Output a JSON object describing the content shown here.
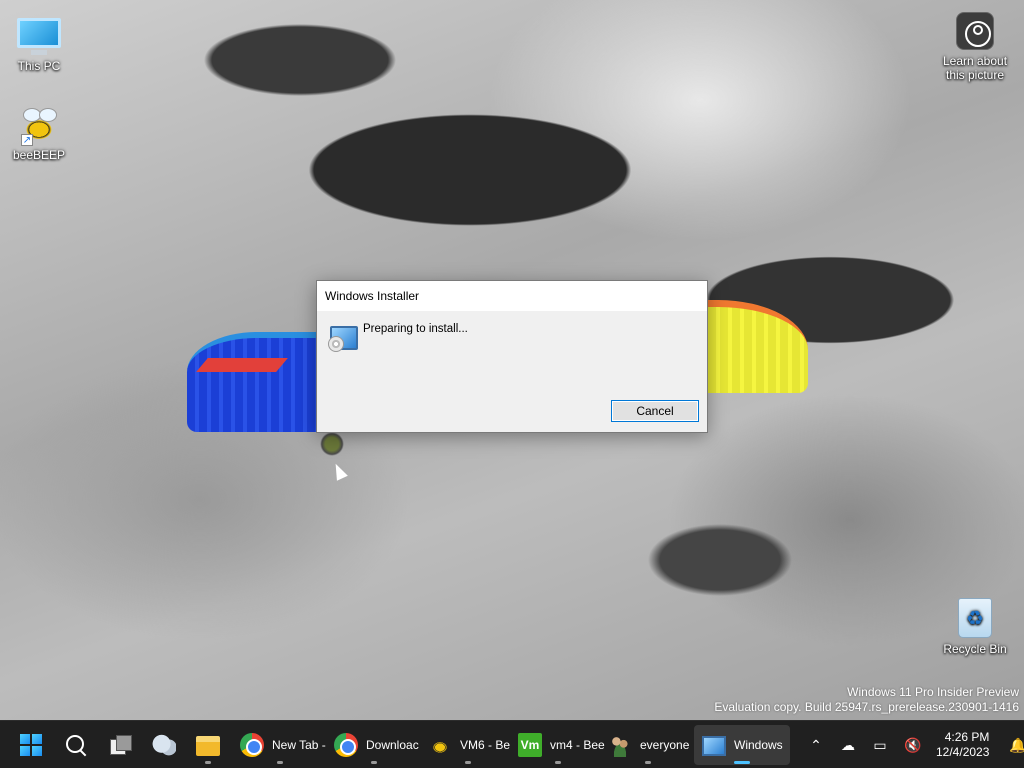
{
  "desktop": {
    "icons": [
      {
        "label": "This PC"
      },
      {
        "label": "beeBEEP"
      },
      {
        "label": "Learn about this picture"
      },
      {
        "label": "Recycle Bin"
      }
    ],
    "watermark": {
      "line1": "Windows 11 Pro Insider Preview",
      "line2": "Evaluation copy. Build 25947.rs_prerelease.230901-1416"
    }
  },
  "dialog": {
    "title": "Windows Installer",
    "message": "Preparing to install...",
    "cancel_label": "Cancel",
    "icon": "installer-icon"
  },
  "taskbar": {
    "pinned": [
      {
        "name": "start",
        "icon": "windows-logo-icon"
      },
      {
        "name": "search",
        "icon": "search-icon"
      },
      {
        "name": "task-view",
        "icon": "task-view-icon"
      },
      {
        "name": "widgets",
        "icon": "weather-icon"
      },
      {
        "name": "file-explorer",
        "icon": "folder-icon"
      }
    ],
    "windows": [
      {
        "label": "New Tab -",
        "icon": "chrome-icon"
      },
      {
        "label": "Downloac",
        "icon": "chrome-icon"
      },
      {
        "label": "VM6 - Be",
        "icon": "beebeep-icon"
      },
      {
        "label": "vm4 - Bee",
        "icon": "vm-icon",
        "icon_text": "Vm"
      },
      {
        "label": "everyone",
        "icon": "people-icon"
      },
      {
        "label": "Windows",
        "icon": "installer-icon",
        "active": true
      }
    ],
    "clock": {
      "time": "4:26 PM",
      "date": "12/4/2023"
    },
    "tray": [
      "chevron-up-icon",
      "onedrive-offline-icon",
      "network-icon",
      "volume-muted-icon",
      "notification-bell-icon"
    ]
  }
}
